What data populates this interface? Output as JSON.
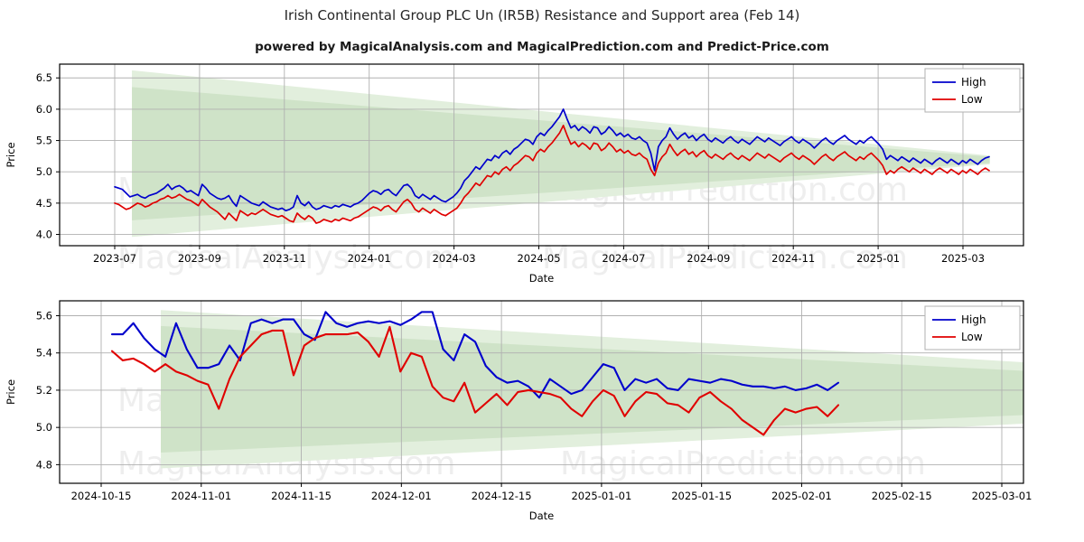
{
  "header": {
    "title": "Irish Continental Group PLC Un (IR5B) Resistance and Support area (Feb 14)",
    "subtitle": "powered by MagicalAnalysis.com and MagicalPrediction.com and Predict-Price.com"
  },
  "watermarks": [
    "MagicalAnalysis.com",
    "MagicalPrediction.com"
  ],
  "colors": {
    "high": "#0000cc",
    "low": "#e00000",
    "band_light": "#e2efdd",
    "band_dark": "#cfe3c8",
    "grid": "#b0b0b0",
    "axis": "#000000"
  },
  "legend": {
    "high_label": "High",
    "low_label": "Low"
  },
  "chart_data": [
    {
      "id": "overview",
      "type": "line",
      "title": "Irish Continental Group PLC Un (IR5B) Resistance and Support area (Feb 14)",
      "xlabel": "Date",
      "ylabel": "Price",
      "ylim": [
        3.82,
        6.72
      ],
      "yticks": [
        4.0,
        4.5,
        5.0,
        5.5,
        6.0,
        6.5
      ],
      "ytick_labels": [
        "4.0",
        "4.5",
        "5.0",
        "5.5",
        "6.0",
        "6.5"
      ],
      "xlim": [
        "2023-06-15",
        "2025-03-20"
      ],
      "xticks": [
        "2023-07",
        "2023-09",
        "2023-11",
        "2024-01",
        "2024-03",
        "2024-05",
        "2024-07",
        "2024-09",
        "2024-11",
        "2025-01",
        "2025-03"
      ],
      "grid": true,
      "legend_position": "upper-right",
      "band": {
        "label": "Resistance and Support area",
        "x_start_frac": 0.075,
        "x_end_frac": 0.965,
        "upper_start": 6.62,
        "upper_end": 5.26,
        "lower_start": 3.96,
        "lower_end": 5.12
      },
      "series": [
        {
          "name": "High",
          "color": "#0000cc",
          "values": [
            4.76,
            4.74,
            4.72,
            4.66,
            4.6,
            4.62,
            4.64,
            4.6,
            4.58,
            4.62,
            4.64,
            4.66,
            4.7,
            4.74,
            4.8,
            4.72,
            4.76,
            4.78,
            4.74,
            4.68,
            4.7,
            4.66,
            4.62,
            4.8,
            4.74,
            4.66,
            4.62,
            4.58,
            4.56,
            4.58,
            4.62,
            4.52,
            4.45,
            4.62,
            4.58,
            4.54,
            4.5,
            4.48,
            4.46,
            4.52,
            4.48,
            4.44,
            4.42,
            4.4,
            4.42,
            4.38,
            4.4,
            4.44,
            4.62,
            4.5,
            4.46,
            4.52,
            4.44,
            4.4,
            4.42,
            4.46,
            4.44,
            4.42,
            4.46,
            4.44,
            4.48,
            4.46,
            4.44,
            4.48,
            4.5,
            4.54,
            4.6,
            4.66,
            4.7,
            4.68,
            4.64,
            4.7,
            4.72,
            4.66,
            4.62,
            4.7,
            4.78,
            4.8,
            4.74,
            4.62,
            4.58,
            4.64,
            4.6,
            4.56,
            4.62,
            4.58,
            4.54,
            4.52,
            4.56,
            4.6,
            4.66,
            4.74,
            4.86,
            4.92,
            5.0,
            5.08,
            5.04,
            5.12,
            5.2,
            5.18,
            5.26,
            5.22,
            5.3,
            5.34,
            5.28,
            5.36,
            5.4,
            5.46,
            5.52,
            5.5,
            5.44,
            5.56,
            5.62,
            5.58,
            5.66,
            5.72,
            5.8,
            5.88,
            6.0,
            5.84,
            5.7,
            5.74,
            5.66,
            5.72,
            5.68,
            5.62,
            5.72,
            5.7,
            5.6,
            5.64,
            5.72,
            5.66,
            5.58,
            5.62,
            5.56,
            5.6,
            5.54,
            5.52,
            5.56,
            5.5,
            5.46,
            5.3,
            5.02,
            5.4,
            5.5,
            5.56,
            5.7,
            5.6,
            5.52,
            5.58,
            5.62,
            5.54,
            5.58,
            5.5,
            5.56,
            5.6,
            5.52,
            5.48,
            5.54,
            5.5,
            5.46,
            5.52,
            5.56,
            5.5,
            5.46,
            5.52,
            5.48,
            5.44,
            5.5,
            5.56,
            5.52,
            5.48,
            5.54,
            5.5,
            5.46,
            5.42,
            5.48,
            5.52,
            5.56,
            5.5,
            5.46,
            5.52,
            5.48,
            5.44,
            5.38,
            5.44,
            5.5,
            5.54,
            5.48,
            5.44,
            5.5,
            5.54,
            5.58,
            5.52,
            5.48,
            5.44,
            5.5,
            5.46,
            5.52,
            5.56,
            5.5,
            5.44,
            5.36,
            5.2,
            5.26,
            5.22,
            5.18,
            5.24,
            5.2,
            5.16,
            5.22,
            5.18,
            5.14,
            5.2,
            5.16,
            5.12,
            5.18,
            5.22,
            5.18,
            5.14,
            5.2,
            5.16,
            5.12,
            5.18,
            5.14,
            5.2,
            5.16,
            5.12,
            5.18,
            5.22,
            5.24
          ]
        },
        {
          "name": "Low",
          "color": "#e00000",
          "values": [
            4.5,
            4.48,
            4.44,
            4.4,
            4.42,
            4.46,
            4.5,
            4.48,
            4.44,
            4.46,
            4.5,
            4.52,
            4.56,
            4.58,
            4.62,
            4.58,
            4.6,
            4.64,
            4.6,
            4.56,
            4.54,
            4.5,
            4.46,
            4.56,
            4.5,
            4.44,
            4.4,
            4.36,
            4.3,
            4.24,
            4.34,
            4.28,
            4.22,
            4.38,
            4.34,
            4.3,
            4.34,
            4.32,
            4.36,
            4.4,
            4.36,
            4.32,
            4.3,
            4.28,
            4.3,
            4.26,
            4.22,
            4.2,
            4.34,
            4.28,
            4.24,
            4.3,
            4.26,
            4.18,
            4.2,
            4.24,
            4.22,
            4.2,
            4.24,
            4.22,
            4.26,
            4.24,
            4.22,
            4.26,
            4.28,
            4.32,
            4.36,
            4.4,
            4.44,
            4.42,
            4.38,
            4.44,
            4.46,
            4.4,
            4.36,
            4.44,
            4.52,
            4.56,
            4.5,
            4.4,
            4.36,
            4.42,
            4.38,
            4.34,
            4.4,
            4.36,
            4.32,
            4.3,
            4.34,
            4.38,
            4.42,
            4.5,
            4.6,
            4.66,
            4.74,
            4.82,
            4.78,
            4.86,
            4.94,
            4.92,
            5.0,
            4.96,
            5.04,
            5.08,
            5.02,
            5.1,
            5.14,
            5.2,
            5.26,
            5.24,
            5.18,
            5.3,
            5.36,
            5.32,
            5.4,
            5.46,
            5.54,
            5.62,
            5.74,
            5.58,
            5.44,
            5.48,
            5.4,
            5.46,
            5.42,
            5.36,
            5.46,
            5.44,
            5.34,
            5.38,
            5.46,
            5.4,
            5.32,
            5.36,
            5.3,
            5.34,
            5.28,
            5.26,
            5.3,
            5.24,
            5.2,
            5.04,
            4.94,
            5.14,
            5.24,
            5.3,
            5.44,
            5.34,
            5.26,
            5.32,
            5.36,
            5.28,
            5.32,
            5.24,
            5.3,
            5.34,
            5.26,
            5.22,
            5.28,
            5.24,
            5.2,
            5.26,
            5.3,
            5.24,
            5.2,
            5.26,
            5.22,
            5.18,
            5.24,
            5.3,
            5.26,
            5.22,
            5.28,
            5.24,
            5.2,
            5.16,
            5.22,
            5.26,
            5.3,
            5.24,
            5.2,
            5.26,
            5.22,
            5.18,
            5.12,
            5.18,
            5.24,
            5.28,
            5.22,
            5.18,
            5.24,
            5.28,
            5.32,
            5.26,
            5.22,
            5.18,
            5.24,
            5.2,
            5.26,
            5.3,
            5.24,
            5.18,
            5.1,
            4.96,
            5.02,
            4.98,
            5.04,
            5.08,
            5.04,
            5.0,
            5.06,
            5.02,
            4.98,
            5.04,
            5.0,
            4.96,
            5.02,
            5.06,
            5.02,
            4.98,
            5.04,
            5.0,
            4.96,
            5.02,
            4.98,
            5.04,
            5.0,
            4.96,
            5.02,
            5.06,
            5.02
          ]
        }
      ]
    },
    {
      "id": "zoomed",
      "type": "line",
      "xlabel": "Date",
      "ylabel": "Price",
      "ylim": [
        4.7,
        5.68
      ],
      "yticks": [
        4.8,
        5.0,
        5.2,
        5.4,
        5.6
      ],
      "ytick_labels": [
        "4.8",
        "5.0",
        "5.2",
        "5.4",
        "5.6"
      ],
      "xlim": [
        "2024-10-12",
        "2025-03-06"
      ],
      "xticks": [
        "2024-10-15",
        "2024-11-01",
        "2024-11-15",
        "2024-12-01",
        "2024-12-15",
        "2025-01-01",
        "2025-01-15",
        "2025-02-01",
        "2025-02-15",
        "2025-03-01"
      ],
      "grid": true,
      "legend_position": "upper-right",
      "band": {
        "label": "Resistance and Support area",
        "x_start_frac": 0.105,
        "x_end_frac": 1.0,
        "upper_start": 5.63,
        "upper_end": 5.35,
        "lower_start": 4.78,
        "lower_end": 5.02
      },
      "series": [
        {
          "name": "High",
          "color": "#0000cc",
          "values": [
            5.5,
            5.5,
            5.56,
            5.48,
            5.42,
            5.38,
            5.56,
            5.42,
            5.32,
            5.32,
            5.34,
            5.44,
            5.36,
            5.56,
            5.58,
            5.56,
            5.58,
            5.58,
            5.5,
            5.47,
            5.62,
            5.56,
            5.54,
            5.56,
            5.57,
            5.56,
            5.57,
            5.55,
            5.58,
            5.62,
            5.62,
            5.42,
            5.36,
            5.5,
            5.46,
            5.33,
            5.27,
            5.24,
            5.25,
            5.22,
            5.16,
            5.26,
            5.22,
            5.18,
            5.2,
            5.27,
            5.34,
            5.32,
            5.2,
            5.26,
            5.24,
            5.26,
            5.21,
            5.2,
            5.26,
            5.25,
            5.24,
            5.26,
            5.25,
            5.23,
            5.22,
            5.22,
            5.21,
            5.22,
            5.2,
            5.21,
            5.23,
            5.2,
            5.24
          ]
        },
        {
          "name": "Low",
          "color": "#e00000",
          "values": [
            5.41,
            5.36,
            5.37,
            5.34,
            5.3,
            5.34,
            5.3,
            5.28,
            5.25,
            5.23,
            5.1,
            5.26,
            5.38,
            5.44,
            5.5,
            5.52,
            5.52,
            5.28,
            5.44,
            5.48,
            5.5,
            5.5,
            5.5,
            5.51,
            5.46,
            5.38,
            5.54,
            5.3,
            5.4,
            5.38,
            5.22,
            5.16,
            5.14,
            5.24,
            5.08,
            5.13,
            5.18,
            5.12,
            5.19,
            5.2,
            5.19,
            5.18,
            5.16,
            5.1,
            5.06,
            5.14,
            5.2,
            5.17,
            5.06,
            5.14,
            5.19,
            5.18,
            5.13,
            5.12,
            5.08,
            5.16,
            5.19,
            5.14,
            5.1,
            5.04,
            5.0,
            4.96,
            5.04,
            5.1,
            5.08,
            5.1,
            5.11,
            5.06,
            5.12
          ]
        }
      ]
    }
  ]
}
